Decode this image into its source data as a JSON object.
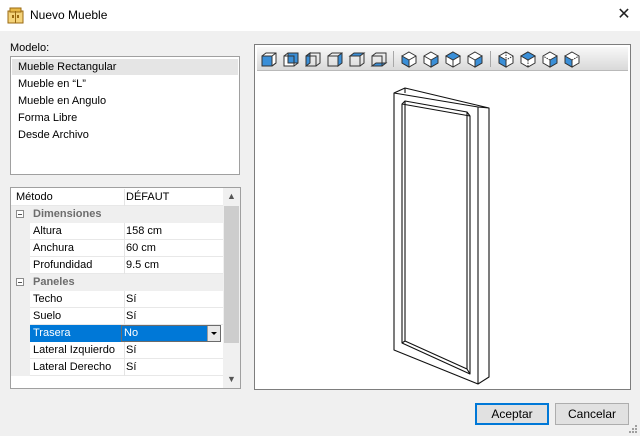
{
  "window": {
    "title": "Nuevo Mueble"
  },
  "model": {
    "label": "Modelo:",
    "items": [
      "Mueble Rectangular",
      "Mueble en “L”",
      "Mueble en Angulo",
      "Forma Libre",
      "Desde Archivo"
    ],
    "selected": "Mueble Rectangular"
  },
  "properties": {
    "header": {
      "name": "Método",
      "value": "DÉFAUT"
    },
    "dimensiones": {
      "label": "Dimensiones",
      "rows": [
        {
          "name": "Altura",
          "value": "158 cm"
        },
        {
          "name": "Anchura",
          "value": "60 cm"
        },
        {
          "name": "Profundidad",
          "value": "9.5 cm"
        }
      ]
    },
    "paneles": {
      "label": "Paneles",
      "techo": {
        "name": "Techo",
        "value": "Sí"
      },
      "suelo": {
        "name": "Suelo",
        "value": "Sí"
      },
      "trasera": {
        "name": "Trasera",
        "value": "No"
      },
      "lateral_izquierdo": {
        "name": "Lateral Izquierdo",
        "value": "Sí"
      },
      "lateral_derecho": {
        "name": "Lateral Derecho",
        "value": "Sí"
      }
    }
  },
  "toolbar": {
    "icons": [
      "view-front-icon",
      "view-back-icon",
      "view-left-icon",
      "view-right-icon",
      "view-top-icon",
      "view-bottom-icon",
      "iso-view-1-icon",
      "iso-view-2-icon",
      "iso-view-3-icon",
      "iso-view-4-icon",
      "iso-view-5-icon",
      "iso-view-6-icon",
      "iso-view-7-icon",
      "iso-view-8-icon"
    ]
  },
  "buttons": {
    "accept": "Aceptar",
    "cancel": "Cancelar"
  },
  "colors": {
    "selection": "#0078d7",
    "accent_icon": "#3a8fd8"
  }
}
